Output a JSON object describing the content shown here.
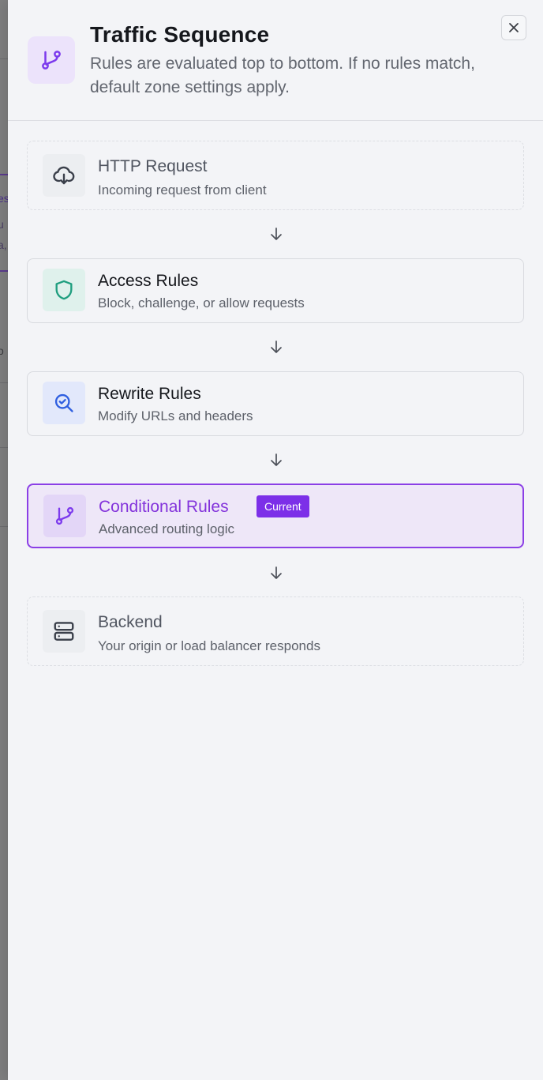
{
  "header": {
    "title": "Traffic Sequence",
    "subtitle": "Rules are evaluated top to bottom. If no rules match, default zone settings apply.",
    "icon": "git-branch-icon",
    "close_icon": "close-icon"
  },
  "backdrop": {
    "fragments": [
      "es",
      "u",
      "a,",
      "o"
    ]
  },
  "steps": [
    {
      "title": "HTTP Request",
      "description": "Incoming request from client",
      "icon": "cloud-download-icon",
      "style": "dashed"
    },
    {
      "title": "Access Rules",
      "description": "Block, challenge, or allow requests",
      "icon": "shield-icon",
      "style": "solid",
      "icon_color": "#1f9e7f",
      "icon_bg": "#dff1ec"
    },
    {
      "title": "Rewrite Rules",
      "description": "Modify URLs and headers",
      "icon": "search-check-icon",
      "style": "solid",
      "icon_color": "#2f5fe0",
      "icon_bg": "#e2e8fb"
    },
    {
      "title": "Conditional Rules",
      "description": "Advanced routing logic",
      "icon": "git-branch-icon",
      "style": "current",
      "badge": "Current",
      "icon_color": "#7c3aed",
      "icon_bg": "#e3d6f7"
    },
    {
      "title": "Backend",
      "description": "Your origin or load balancer responds",
      "icon": "server-icon",
      "style": "dashed"
    }
  ],
  "colors": {
    "accent": "#7c2fe8",
    "panel_bg": "#f3f4f7",
    "border": "#dcdee3"
  }
}
